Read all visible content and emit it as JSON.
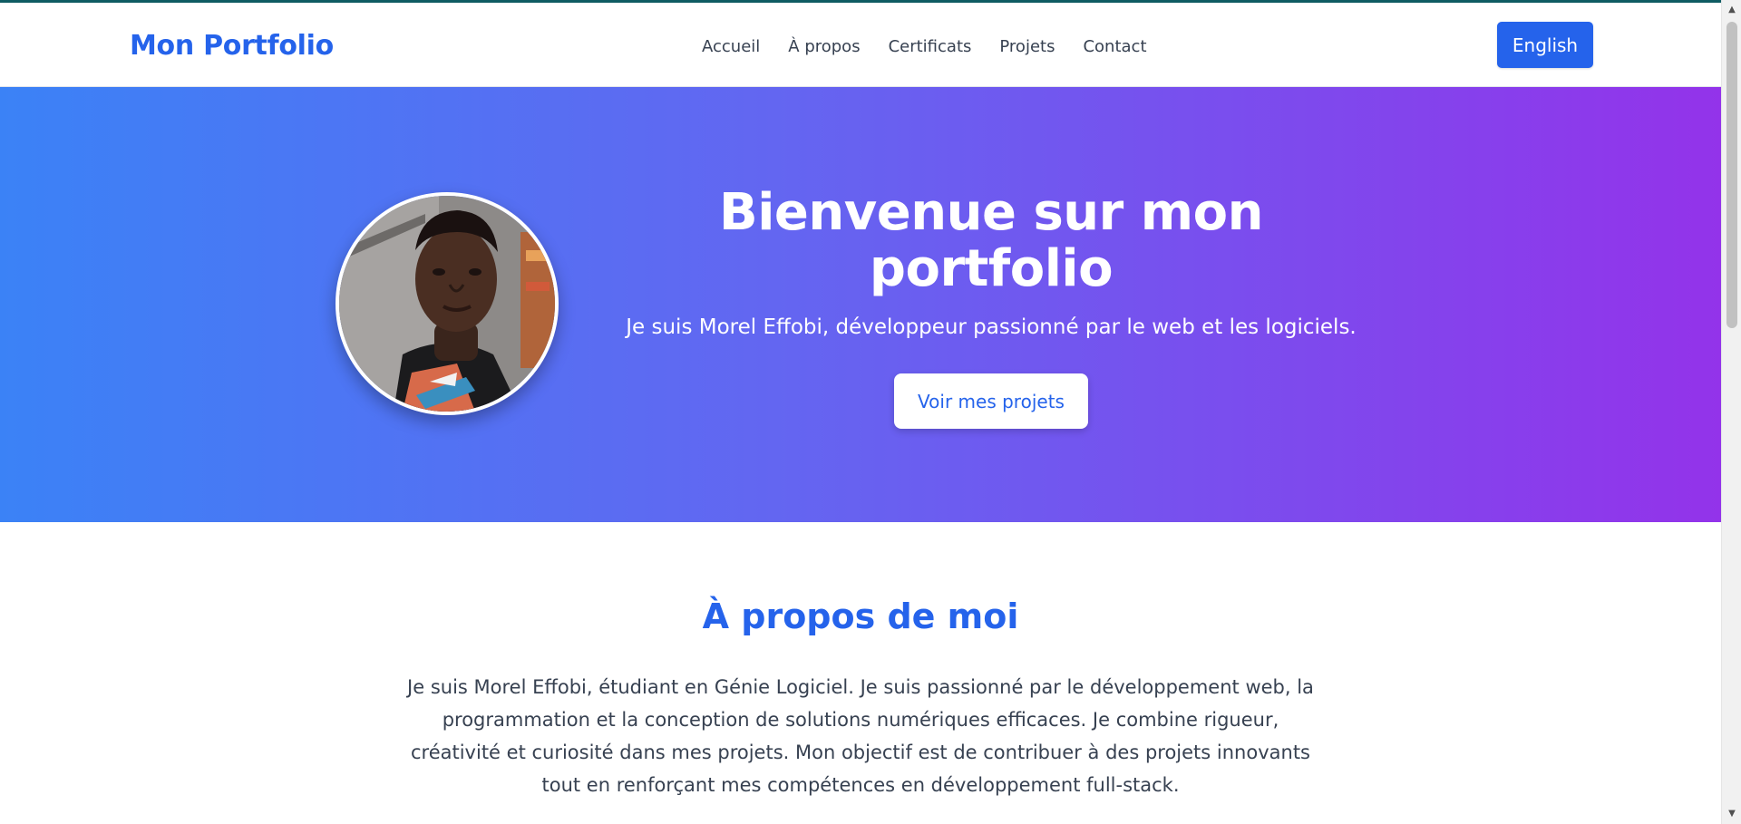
{
  "header": {
    "brand": "Mon Portfolio",
    "nav": [
      "Accueil",
      "À propos",
      "Certificats",
      "Projets",
      "Contact"
    ],
    "language_button": "English"
  },
  "hero": {
    "title": "Bienvenue sur mon portfolio",
    "subtitle": "Je suis Morel Effobi, développeur passionné par le web et les logiciels.",
    "cta": "Voir mes projets",
    "avatar_icon": "profile-photo"
  },
  "about": {
    "title": "À propos de moi",
    "text": "Je suis Morel Effobi, étudiant en Génie Logiciel. Je suis passionné par le développement web, la programmation et la conception de solutions numériques efficaces. Je combine rigueur, créativité et curiosité dans mes projets. Mon objectif est de contribuer à des projets innovants tout en renforçant mes compétences en développement full-stack."
  },
  "colors": {
    "brand": "#2563eb",
    "gradient_start": "#3b82f6",
    "gradient_mid": "#6366f1",
    "gradient_end": "#9333ea"
  }
}
